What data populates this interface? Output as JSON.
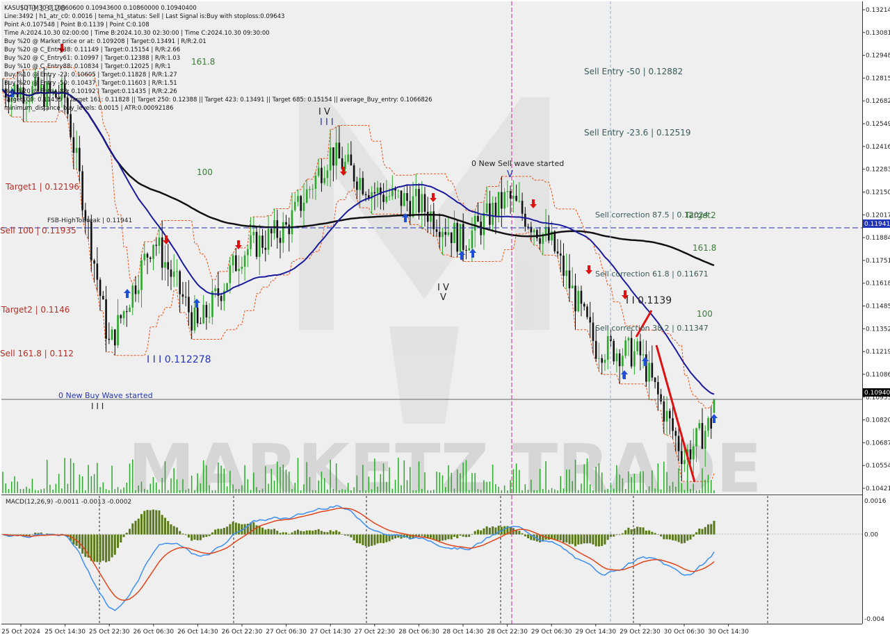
{
  "window": {
    "title": "KASUSDT-M30 chart"
  },
  "header": {
    "lines": [
      "KASUSDT-M30  0.10860600 0.10943600 0.10860000 0.10940400",
      "Line:3492 | h1_atr_c0: 0.0016 | tema_h1_status: Sell | Last Signal is:Buy with stoploss:0.09643",
      "Point A:0.107548 | Point B:0.1139 | Point C:0.108",
      "Time A:2024.10.30 02:00:00 | Time B:2024.10.30 02:30:00 | Time C:2024.10.30 09:30:00",
      "Buy %20 @ Market price or at: 0.109208 | Target:0.13491 | R/R:2.01",
      "Buy %20 @ C_Entry38: 0.11149 | Target:0.15154 | R/R:2.66",
      "Buy %20 @ C_Entry61: 0.10997 | Target:0.12388 | R/R:1.03",
      "Buy %10 @ C_Entry88: 0.10834 | Target:0.12025 | R/R:1",
      "Buy %10 @ Entry -23: 0.10605 | Target:0.11828 | R/R:1.27",
      "Buy %20 @ Entry -50: 0.10437 | Target:0.11603 | R/R:1.51",
      "Buy %20 @ Entry -88: 0.10192 | Target:0.11435 | R/R:2.26",
      "Target100: 0.11435 || Target 161: 0.11828 || Target 250: 0.12388 || Target 423: 0.13491 || Target 685: 0.15154 || average_Buy_entry: 0.1066826",
      "minimum_distance_buy_levels: 0.0015 | ATR:0.00092186"
    ]
  },
  "watermark": {
    "text": "MARKETZ TRADE"
  },
  "price_axis": {
    "labels": [
      "0.13214",
      "0.13081",
      "0.12948",
      "0.12815",
      "0.12682",
      "0.12549",
      "0.12416",
      "0.12283",
      "0.12150",
      "0.12017",
      "0.11884",
      "0.11751",
      "0.11618",
      "0.11485",
      "0.11352",
      "0.11219",
      "0.11086",
      "0.10953",
      "0.10820",
      "0.10687",
      "0.10554",
      "0.10421"
    ],
    "current_price": "0.10940",
    "marker_price": "0.11941"
  },
  "macd_axis": {
    "labels": [
      "0.0016",
      "0.00",
      "-0.004"
    ]
  },
  "time_axis": {
    "labels": [
      "25 Oct 2024",
      "25 Oct 14:30",
      "25 Oct 22:30",
      "26 Oct 06:30",
      "26 Oct 14:30",
      "26 Oct 22:30",
      "27 Oct 06:30",
      "27 Oct 14:30",
      "27 Oct 22:30",
      "28 Oct 06:30",
      "28 Oct 14:30",
      "28 Oct 22:30",
      "29 Oct 06:30",
      "29 Oct 14:30",
      "29 Oct 22:30",
      "30 Oct 06:30",
      "30 Oct 14:30"
    ]
  },
  "annotations": {
    "target1": "Target1 | 0.12196",
    "sell100": "Sell 100 | 0.11935",
    "target2_left": "Target2 | 0.1146",
    "sell161": "Sell 161.8 | 0.112",
    "fsb": "FSB-HighToBreak | 0.11941",
    "new_buy_wave": "0 New Buy Wave started",
    "new_sell_wave": "0 New Sell wave started",
    "low_wave": "I I I 0.112278",
    "wave_iv_top": "I V",
    "wave_iii_top": "I I I",
    "wave_v_top": "V",
    "wave_iv_bottom": "I V",
    "wave_v_bottom": "V",
    "wave_ii": "I I I",
    "fib_161_top": "161.8",
    "fib_100_top": "100",
    "sell_entry_50": "Sell Entry -50 | 0.12882",
    "sell_entry_23": "Sell Entry -23.6 | 0.12519",
    "sell_corr_875": "Sell correction 87.5 | 0.12024",
    "target2_right": "Target2",
    "fib_1618_right": "161.8",
    "sell_corr_618": "Sell correction 61.8 | 0.11671",
    "point_b": "I I 0.1139",
    "sell_corr_38": "Sell correction 38.2 | 0.11347",
    "fib_100_right": "100",
    "top_label": "I I 0.13120"
  },
  "macd": {
    "label": "MACD(12,26,9) -0.0011 -0.0013 -0.0002"
  },
  "colors": {
    "bull": "#2aa82a",
    "bear": "#111111",
    "ma200": "#111111",
    "ma50": "#1a1a9c",
    "envelope": "#e8541c",
    "signal_buy": "#1f4fd8",
    "signal_sell": "#e01010",
    "macd_hist": "#5a7a1a",
    "macd_line": "#3b8ff0",
    "signal_line": "#e0451a",
    "level_blue": "#2233bb",
    "annot_red": "#b03028",
    "annot_green": "#3a7a3a"
  },
  "chart_data": {
    "type": "candlestick",
    "symbol": "KASUSDT",
    "timeframe": "M30",
    "ohlc_last": {
      "open": 0.108606,
      "high": 0.109436,
      "low": 0.1086,
      "close": 0.109404
    },
    "ylim": [
      0.1034,
      0.1323
    ],
    "key_levels": {
      "fsb_high_to_break": 0.11941,
      "current_price": 0.1094,
      "sell_entry_minus_50": 0.12882,
      "sell_entry_minus_23_6": 0.12519,
      "sell_correction_87_5": 0.12024,
      "sell_correction_61_8": 0.11671,
      "sell_correction_38_2": 0.11347,
      "target1": 0.12196,
      "sell_100": 0.11935,
      "target2": 0.1146,
      "sell_161_8": 0.112
    },
    "price_path": [
      {
        "t": "25 Oct 2024",
        "p": 0.1275
      },
      {
        "t": "25 Oct 14:30",
        "p": 0.127
      },
      {
        "t": "25 Oct 22:30",
        "p": 0.1125
      },
      {
        "t": "26 Oct 06:30",
        "p": 0.1188
      },
      {
        "t": "26 Oct 14:30",
        "p": 0.1135
      },
      {
        "t": "26 Oct 22:30",
        "p": 0.118
      },
      {
        "t": "27 Oct 06:30",
        "p": 0.1194
      },
      {
        "t": "27 Oct 14:30",
        "p": 0.1238
      },
      {
        "t": "27 Oct 22:30",
        "p": 0.1215
      },
      {
        "t": "28 Oct 06:30",
        "p": 0.1208
      },
      {
        "t": "28 Oct 14:30",
        "p": 0.1186
      },
      {
        "t": "28 Oct 22:30",
        "p": 0.1212
      },
      {
        "t": "29 Oct 06:30",
        "p": 0.1185
      },
      {
        "t": "29 Oct 14:30",
        "p": 0.1125
      },
      {
        "t": "29 Oct 22:30",
        "p": 0.112
      },
      {
        "t": "30 Oct 06:30",
        "p": 0.106
      },
      {
        "t": "30 Oct 14:30",
        "p": 0.1094
      }
    ],
    "macd": {
      "params": [
        12,
        26,
        9
      ],
      "main": -0.0011,
      "signal": -0.0013,
      "histogram": -0.0002,
      "ylim": [
        -0.004,
        0.0016
      ]
    }
  }
}
